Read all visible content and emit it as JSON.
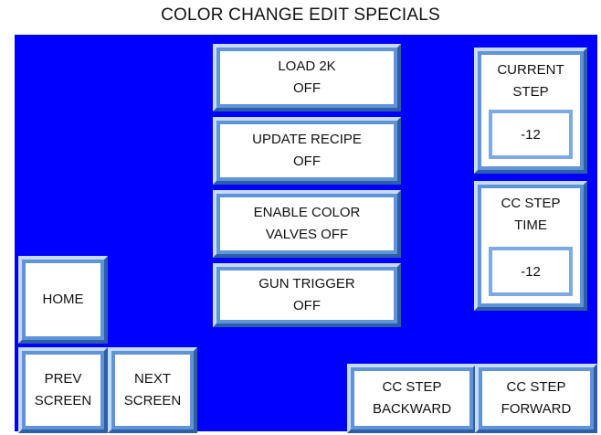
{
  "screen_title": "COLOR CHANGE EDIT SPECIALS",
  "buttons": {
    "load_2k": "LOAD 2K\nOFF",
    "update_recipe": "UPDATE RECIPE\nOFF",
    "enable_color_valves": "ENABLE COLOR\nVALVES OFF",
    "gun_trigger": "GUN TRIGGER\nOFF",
    "home": "HOME",
    "prev_screen": "PREV\nSCREEN",
    "next_screen": "NEXT\nSCREEN",
    "cc_step_backward": "CC STEP\nBACKWARD",
    "cc_step_forward": "CC STEP\nFORWARD"
  },
  "displays": {
    "current_step": {
      "label": "CURRENT\nSTEP",
      "value": "-12"
    },
    "cc_step_time": {
      "label": "CC STEP\nTIME",
      "value": "-12"
    }
  },
  "colors": {
    "panel_background": "#0000ff",
    "button_bevel": "#5f94d8",
    "button_face": "#ffffff"
  }
}
